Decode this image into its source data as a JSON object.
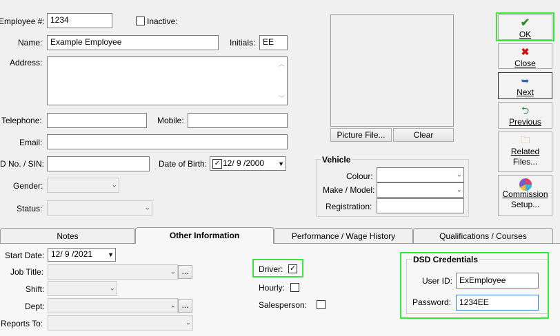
{
  "form": {
    "employee_no_label": "Employee #:",
    "employee_no": "1234",
    "inactive_label": "Inactive:",
    "name_label": "Name:",
    "name": "Example Employee",
    "initials_label": "Initials:",
    "initials": "EE",
    "address_label": "Address:",
    "telephone_label": "Telephone:",
    "mobile_label": "Mobile:",
    "email_label": "Email:",
    "id_label": "D No. / SIN:",
    "dob_label": "Date of Birth:",
    "dob": "12/ 9 /2000",
    "gender_label": "Gender:",
    "status_label": "Status:"
  },
  "picture": {
    "picture_file_label": "Picture File...",
    "clear_label": "Clear"
  },
  "vehicle": {
    "title": "Vehicle",
    "colour_label": "Colour:",
    "make_model_label": "Make / Model:",
    "registration_label": "Registration:"
  },
  "actions": {
    "ok": "OK",
    "close": "Close",
    "next": "Next",
    "previous": "Previous",
    "related_files_1": "Related",
    "related_files_2": "Files...",
    "commission_1": "Commission",
    "commission_2": "Setup..."
  },
  "tabs": [
    "Notes",
    "Other Information",
    "Performance / Wage History",
    "Qualifications / Courses"
  ],
  "other_info": {
    "start_date_label": "Start Date:",
    "start_date": "12/ 9 /2021",
    "job_title_label": "Job Title:",
    "shift_label": "Shift:",
    "dept_label": "Dept:",
    "reports_to_label": "Reports To:",
    "ellipsis": "...",
    "driver_label": "Driver:",
    "hourly_label": "Hourly:",
    "salesperson_label": "Salesperson:",
    "check_mark": "✓"
  },
  "dsd": {
    "title": "DSD Credentials",
    "user_id_label": "User ID:",
    "user_id": "ExEmployee",
    "password_label": "Password:",
    "password": "1234EE"
  },
  "colors": {
    "highlight": "#39e639",
    "ok_check": "#2e8b2e",
    "close_x": "#d01010"
  }
}
